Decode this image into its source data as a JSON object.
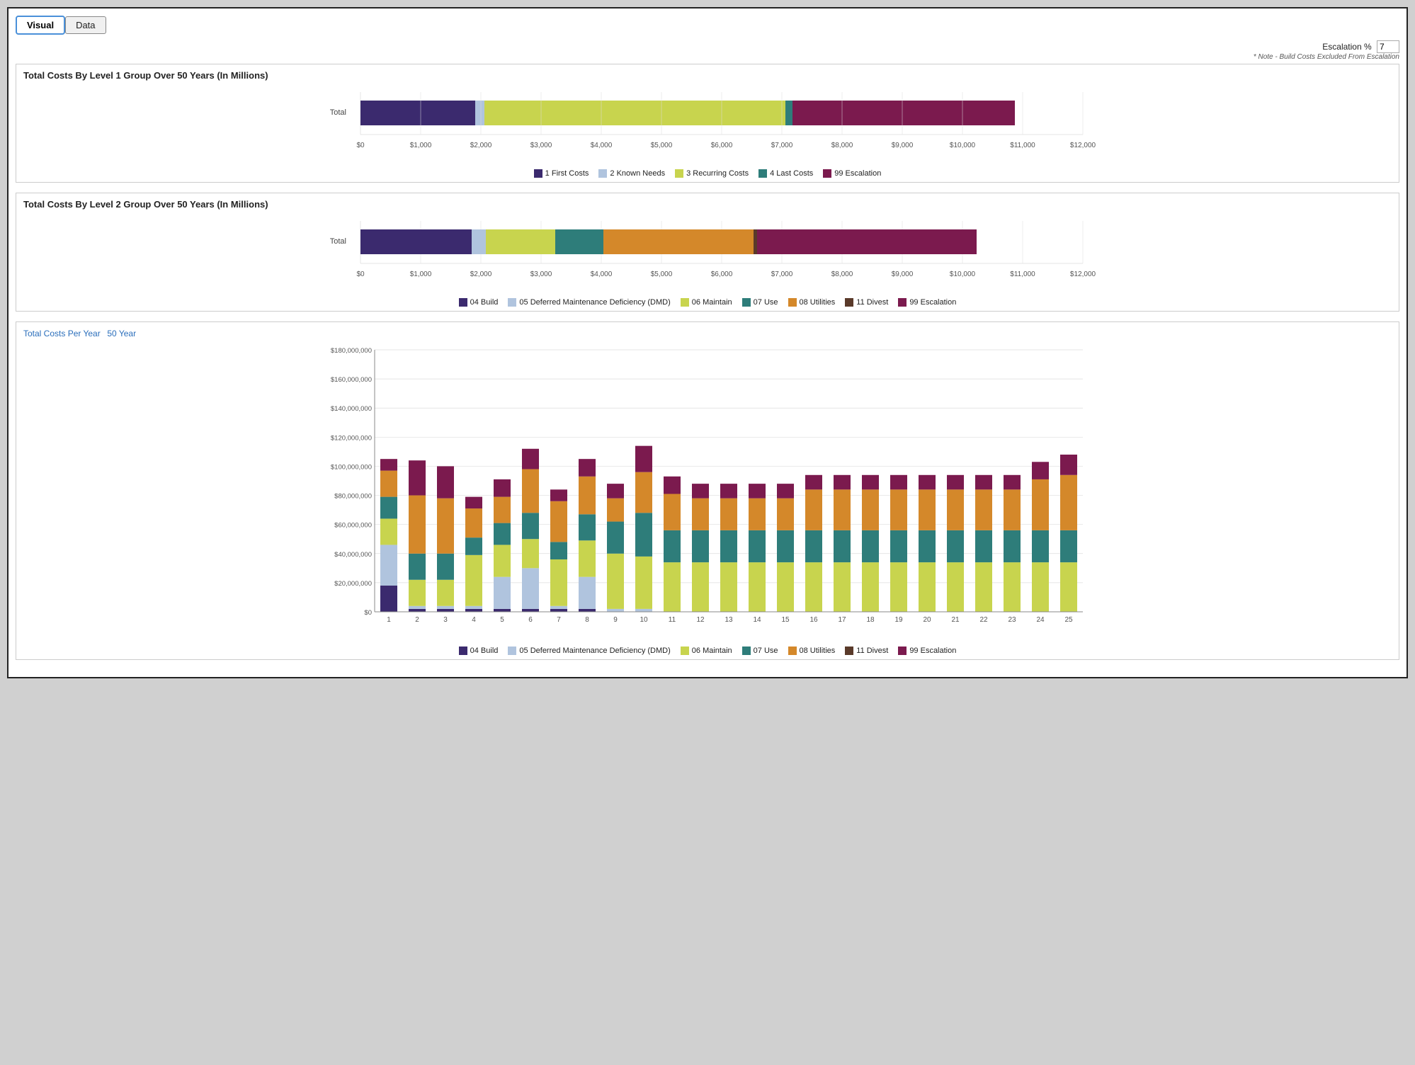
{
  "tabs": [
    {
      "label": "Visual",
      "active": true
    },
    {
      "label": "Data",
      "active": false
    }
  ],
  "escalation": {
    "label": "Escalation %",
    "value": "7",
    "note": "* Note - Build Costs Excluded From Escalation"
  },
  "chart1": {
    "title": "Total Costs By Level 1 Group Over 50 Years (In Millions)",
    "xLabels": [
      "$0",
      "$1,000",
      "$2,000",
      "$3,000",
      "$4,000",
      "$5,000",
      "$6,000",
      "$7,000",
      "$8,000",
      "$9,000",
      "$10,000",
      "$11,000",
      "$12,000"
    ],
    "legend": [
      {
        "label": "1 First Costs",
        "color": "#3b2a6e"
      },
      {
        "label": "2 Known Needs",
        "color": "#b0c4de"
      },
      {
        "label": "3 Recurring Costs",
        "color": "#c8d44e"
      },
      {
        "label": "4 Last Costs",
        "color": "#2e7d7a"
      },
      {
        "label": "99 Escalation",
        "color": "#7b1a4e"
      }
    ],
    "bar": {
      "segments": [
        {
          "label": "1 First Costs",
          "color": "#3b2a6e",
          "pct": 16.5
        },
        {
          "label": "2 Known Needs",
          "color": "#b0c4de",
          "pct": 1.5
        },
        {
          "label": "3 Recurring Costs",
          "color": "#c8d44e",
          "pct": 47
        },
        {
          "label": "4 Last Costs",
          "color": "#2e7d7a",
          "pct": 0
        },
        {
          "label": "99 Escalation",
          "color": "#7b1a4e",
          "pct": 27
        }
      ],
      "totalWidth": 92
    }
  },
  "chart2": {
    "title": "Total Costs By Level 2 Group Over 50 Years (In Millions)",
    "xLabels": [
      "$0",
      "$1,000",
      "$2,000",
      "$3,000",
      "$4,000",
      "$5,000",
      "$6,000",
      "$7,000",
      "$8,000",
      "$9,000",
      "$10,000",
      "$11,000",
      "$12,000"
    ],
    "legend": [
      {
        "label": "04 Build",
        "color": "#3b2a6e"
      },
      {
        "label": "05 Deferred Maintenance Deficiency (DMD)",
        "color": "#b0c4de"
      },
      {
        "label": "06 Maintain",
        "color": "#c8d44e"
      },
      {
        "label": "07 Use",
        "color": "#2e7d7a"
      },
      {
        "label": "08 Utilities",
        "color": "#d4882a"
      },
      {
        "label": "11 Divest",
        "color": "#5a3a2a"
      },
      {
        "label": "99 Escalation",
        "color": "#7b1a4e"
      }
    ],
    "bar": {
      "segments": [
        {
          "label": "04 Build",
          "color": "#3b2a6e",
          "pct": 15.5
        },
        {
          "label": "05 DMD",
          "color": "#b0c4de",
          "pct": 2
        },
        {
          "label": "06 Maintain",
          "color": "#c8d44e",
          "pct": 15
        },
        {
          "label": "07 Use",
          "color": "#2e7d7a",
          "pct": 9
        },
        {
          "label": "08 Utilities",
          "color": "#d4882a",
          "pct": 22
        },
        {
          "label": "11 Divest",
          "color": "#5a3a2a",
          "pct": 0
        },
        {
          "label": "99 Escalation",
          "color": "#7b1a4e",
          "pct": 28
        }
      ],
      "totalWidth": 92
    }
  },
  "chart3": {
    "title": "Total Costs Per Year",
    "yearLabel": "50 Year",
    "yLabels": [
      "$0",
      "$20,000,000",
      "$40,000,000",
      "$60,000,000",
      "$80,000,000",
      "$100,000,000",
      "$120,000,000",
      "$140,000,000",
      "$160,000,000",
      "$180,000,000"
    ],
    "xLabels": [
      "1",
      "2",
      "3",
      "4",
      "5",
      "6",
      "7",
      "8",
      "9",
      "10",
      "11",
      "12",
      "13",
      "14",
      "15",
      "16",
      "17",
      "18",
      "19",
      "20",
      "21",
      "22",
      "23",
      "24",
      "25"
    ],
    "legend": [
      {
        "label": "04 Build",
        "color": "#3b2a6e"
      },
      {
        "label": "05 Deferred Maintenance Deficiency (DMD)",
        "color": "#b0c4de"
      },
      {
        "label": "06 Maintain",
        "color": "#c8d44e"
      },
      {
        "label": "07 Use",
        "color": "#2e7d7a"
      },
      {
        "label": "08 Utilities",
        "color": "#d4882a"
      },
      {
        "label": "11 Divest",
        "color": "#5a3a2a"
      },
      {
        "label": "99 Escalation",
        "color": "#7b1a4e"
      }
    ],
    "bars": [
      {
        "build": 18,
        "dmd": 28,
        "maintain": 18,
        "use": 15,
        "utilities": 18,
        "divest": 0,
        "escalation": 8
      },
      {
        "build": 2,
        "dmd": 2,
        "maintain": 18,
        "use": 18,
        "utilities": 40,
        "divest": 0,
        "escalation": 24
      },
      {
        "build": 2,
        "dmd": 2,
        "maintain": 18,
        "use": 18,
        "utilities": 38,
        "divest": 0,
        "escalation": 22
      },
      {
        "build": 2,
        "dmd": 2,
        "maintain": 35,
        "use": 12,
        "utilities": 20,
        "divest": 0,
        "escalation": 8
      },
      {
        "build": 2,
        "dmd": 22,
        "maintain": 22,
        "use": 15,
        "utilities": 18,
        "divest": 0,
        "escalation": 12
      },
      {
        "build": 2,
        "dmd": 28,
        "maintain": 20,
        "use": 18,
        "utilities": 30,
        "divest": 0,
        "escalation": 14
      },
      {
        "build": 2,
        "dmd": 2,
        "maintain": 32,
        "use": 12,
        "utilities": 28,
        "divest": 0,
        "escalation": 8
      },
      {
        "build": 2,
        "dmd": 22,
        "maintain": 25,
        "use": 18,
        "utilities": 26,
        "divest": 0,
        "escalation": 12
      },
      {
        "build": 0,
        "dmd": 2,
        "maintain": 38,
        "use": 22,
        "utilities": 16,
        "divest": 0,
        "escalation": 10
      },
      {
        "build": 0,
        "dmd": 2,
        "maintain": 36,
        "use": 30,
        "utilities": 28,
        "divest": 0,
        "escalation": 18
      },
      {
        "build": 0,
        "dmd": 0,
        "maintain": 34,
        "use": 22,
        "utilities": 25,
        "divest": 0,
        "escalation": 12
      },
      {
        "build": 0,
        "dmd": 0,
        "maintain": 34,
        "use": 22,
        "utilities": 22,
        "divest": 0,
        "escalation": 10
      },
      {
        "build": 0,
        "dmd": 0,
        "maintain": 34,
        "use": 22,
        "utilities": 22,
        "divest": 0,
        "escalation": 10
      },
      {
        "build": 0,
        "dmd": 0,
        "maintain": 34,
        "use": 22,
        "utilities": 22,
        "divest": 0,
        "escalation": 10
      },
      {
        "build": 0,
        "dmd": 0,
        "maintain": 34,
        "use": 22,
        "utilities": 22,
        "divest": 0,
        "escalation": 10
      },
      {
        "build": 0,
        "dmd": 0,
        "maintain": 34,
        "use": 22,
        "utilities": 28,
        "divest": 0,
        "escalation": 10
      },
      {
        "build": 0,
        "dmd": 0,
        "maintain": 34,
        "use": 22,
        "utilities": 28,
        "divest": 0,
        "escalation": 10
      },
      {
        "build": 0,
        "dmd": 0,
        "maintain": 34,
        "use": 22,
        "utilities": 28,
        "divest": 0,
        "escalation": 10
      },
      {
        "build": 0,
        "dmd": 0,
        "maintain": 34,
        "use": 22,
        "utilities": 28,
        "divest": 0,
        "escalation": 10
      },
      {
        "build": 0,
        "dmd": 0,
        "maintain": 34,
        "use": 22,
        "utilities": 28,
        "divest": 0,
        "escalation": 10
      },
      {
        "build": 0,
        "dmd": 0,
        "maintain": 34,
        "use": 22,
        "utilities": 28,
        "divest": 0,
        "escalation": 10
      },
      {
        "build": 0,
        "dmd": 0,
        "maintain": 34,
        "use": 22,
        "utilities": 28,
        "divest": 0,
        "escalation": 10
      },
      {
        "build": 0,
        "dmd": 0,
        "maintain": 34,
        "use": 22,
        "utilities": 28,
        "divest": 0,
        "escalation": 10
      },
      {
        "build": 0,
        "dmd": 0,
        "maintain": 34,
        "use": 22,
        "utilities": 35,
        "divest": 0,
        "escalation": 12
      },
      {
        "build": 0,
        "dmd": 0,
        "maintain": 34,
        "use": 22,
        "utilities": 38,
        "divest": 0,
        "escalation": 14
      }
    ]
  }
}
